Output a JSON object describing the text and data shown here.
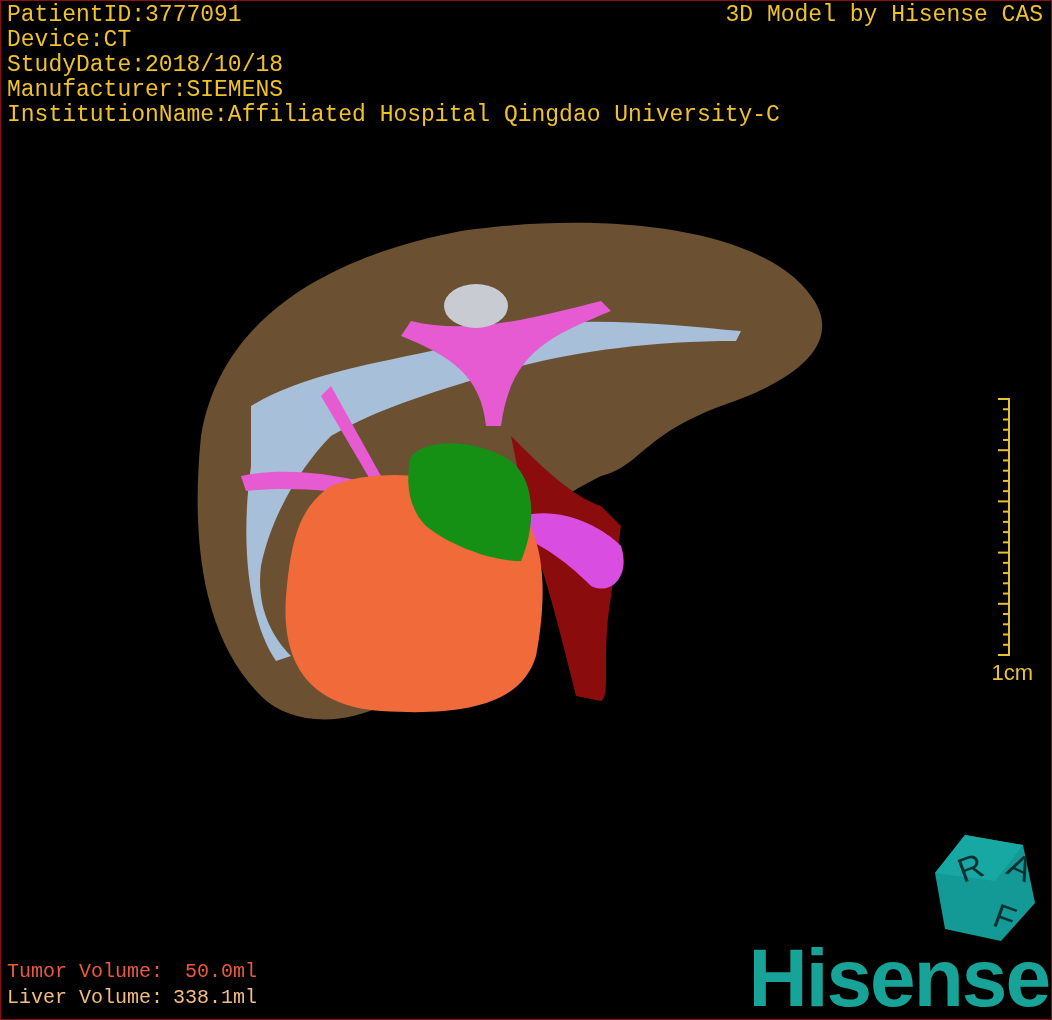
{
  "info_lines": [
    "PatientID:3777091",
    "Device:CT",
    "StudyDate:2018/10/18",
    "Manufacturer:SIEMENS",
    "InstitutionName:Affiliated Hospital Qingdao University-C"
  ],
  "caption": "3D Model by Hisense CAS",
  "viewport": {
    "kind": "model"
  },
  "scale": {
    "label": "1cm"
  },
  "volumes": [
    {
      "label": "Tumor Volume:",
      "value": "50.0ml",
      "color": "#ec5a3c"
    },
    {
      "label": "Liver Volume:",
      "value": "338.1ml",
      "color": "#f2bc80"
    }
  ],
  "orientation_cube": {
    "letters": [
      "R",
      "A",
      "F"
    ]
  },
  "logo": {
    "text": "Hisense"
  }
}
